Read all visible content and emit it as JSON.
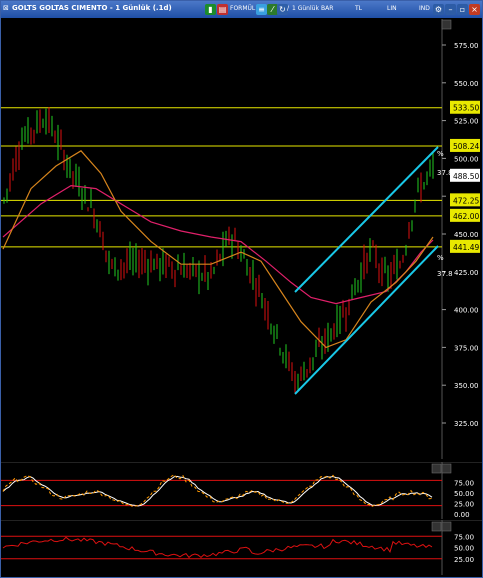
{
  "window": {
    "title": "GOLTS GOLTAS CIMENTO - 1 Günlük (.1d)",
    "toolbar": {
      "period": "1 Günlük",
      "bar": "BAR",
      "tl": "TL",
      "lin": "LIN",
      "ind": "IND",
      "formula_label": "FORMÜL"
    },
    "accent_color": "#2b5cb8"
  },
  "main_panel": {
    "y_ticks": [
      "575.00",
      "550.00",
      "525.00",
      "500.00",
      "475.00",
      "450.00",
      "425.00",
      "400.00",
      "375.00",
      "350.00",
      "325.00"
    ],
    "level_lines": [
      {
        "value": "533.50",
        "color": "#e8e800"
      },
      {
        "value": "508.24",
        "color": "#e8e800"
      },
      {
        "value": "488.50",
        "color": "#ffffff"
      },
      {
        "value": "472.25",
        "color": "#e8e800"
      },
      {
        "value": "462.00",
        "color": "#e8e800"
      },
      {
        "value": "441.49",
        "color": "#e8e800"
      }
    ],
    "channel_labels": [
      "%",
      "37.8",
      "%",
      "37.8"
    ],
    "channel_color": "#19c8e8",
    "candle_up_color": "#22cc22",
    "candle_down_color": "#dd1111",
    "ma_fast_color": "#d6841c",
    "ma_slow_color": "#e0206a"
  },
  "stoch_panel": {
    "y_ticks": [
      "75.00",
      "50.00",
      "25.00",
      "0.00"
    ],
    "k_color": "#ff9900",
    "d_color": "#ffffff",
    "band_color": "#dd1111"
  },
  "rsi_panel": {
    "y_ticks": [
      "75.00",
      "50.00",
      "25.00"
    ],
    "line_color": "#dd1111"
  }
}
